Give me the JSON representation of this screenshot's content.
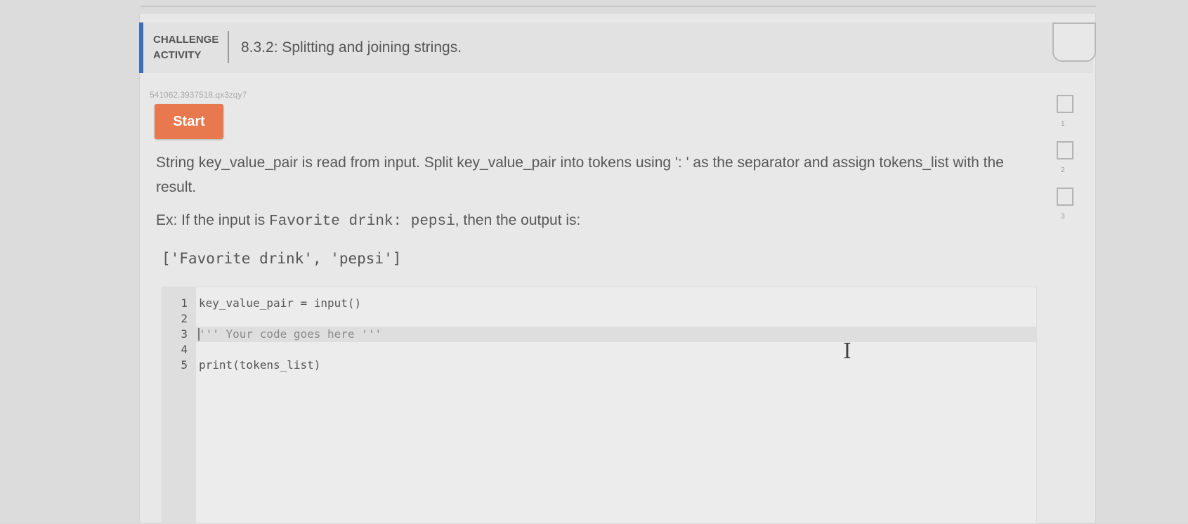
{
  "header": {
    "label_line1": "CHALLENGE",
    "label_line2": "ACTIVITY",
    "title": "8.3.2: Splitting and joining strings."
  },
  "activity_id": "541062.3937518.qx3zqy7",
  "start_button": "Start",
  "levels": [
    {
      "number": "1"
    },
    {
      "number": "2"
    },
    {
      "number": "3"
    }
  ],
  "description": "String key_value_pair is read from input. Split key_value_pair into tokens using ': ' as the separator and assign tokens_list with the result.",
  "example": {
    "prefix": "Ex: If the input is ",
    "input": "Favorite drink: pepsi",
    "suffix": ", then the output is:",
    "output": "['Favorite drink', 'pepsi']"
  },
  "editor": {
    "lines": [
      {
        "num": "1",
        "code": "key_value_pair = input()"
      },
      {
        "num": "2",
        "code": ""
      },
      {
        "num": "3",
        "code": "''' Your code goes here '''"
      },
      {
        "num": "4",
        "code": ""
      },
      {
        "num": "5",
        "code": "print(tokens_list)"
      }
    ]
  },
  "colors": {
    "accent": "#3d6fb8",
    "start_button": "#e8784d"
  },
  "icons": [
    "text-cursor-icon"
  ]
}
